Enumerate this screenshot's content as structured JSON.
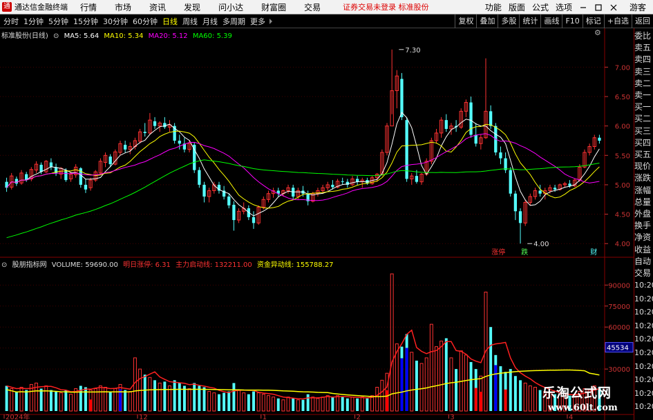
{
  "menubar": {
    "app_name": "通达信金融终端",
    "items": [
      "行情",
      "市场",
      "资讯",
      "发现",
      "问小达",
      "财富圈",
      "交易"
    ],
    "notice": "证券交易未登录  标准股份",
    "right_items": [
      "功能",
      "版面",
      "公式",
      "选项"
    ],
    "user": "游客"
  },
  "periodbar": {
    "periods": [
      "分时",
      "1分钟",
      "5分钟",
      "15分钟",
      "30分钟",
      "60分钟",
      "日线",
      "周线",
      "月线",
      "多周期",
      "更多"
    ],
    "active": "日线",
    "tools": [
      "复权",
      "叠加",
      "多股",
      "统计",
      "画线",
      "F10",
      "标记",
      "+自选",
      "返回"
    ]
  },
  "price_legend": {
    "stock": "标准股份(日线)",
    "ma5": "MA5: 5.64",
    "ma10": "MA10: 5.34",
    "ma20": "MA20: 5.12",
    "ma60": "MA60: 5.39",
    "colors": {
      "ma5": "#ffffff",
      "ma10": "#ffff00",
      "ma20": "#ff00ff",
      "ma60": "#00ff00"
    }
  },
  "vol_legend": {
    "indicator": "股朋指标网",
    "volume": "VOLUME: 59690.00",
    "next_limit": "明日涨停: 6.31",
    "main_line": "主力启动线: 132211.00",
    "abnormal_line": "资金异动线: 155788.27"
  },
  "right_panel": {
    "labels": [
      "委比",
      "卖五",
      "卖四",
      "卖三",
      "卖二",
      "卖一",
      "买一",
      "买二",
      "买三",
      "买四",
      "买五",
      "现价",
      "涨跌",
      "涨幅",
      "总量",
      "外盘",
      "换手",
      "净资",
      "收益",
      "自动",
      "交易"
    ],
    "times": [
      "10:20",
      "10:20",
      "10:20",
      "10:20",
      "10:20",
      "10:20",
      "10:20",
      "10:20",
      "10:20",
      "10:20"
    ]
  },
  "annotations": {
    "high_label": "7.30",
    "low_label": "4.00",
    "tags": [
      "涨停",
      "跌",
      "财"
    ],
    "current_volume_box": "45534"
  },
  "watermark": {
    "line1": "乐淘公式网",
    "line2": "www.60lt.com"
  },
  "chart_data": {
    "type": "candlestick",
    "price_axis": {
      "ticks": [
        4.0,
        4.5,
        5.0,
        5.5,
        6.0,
        6.5,
        7.0
      ],
      "range": [
        3.85,
        7.45
      ]
    },
    "volume_axis": {
      "ticks": [
        30000,
        45000,
        60000,
        75000,
        90000
      ],
      "range": [
        0,
        101000
      ]
    },
    "x_labels": [
      "2024年",
      "12",
      "1",
      "2",
      "3",
      "4"
    ],
    "x_label_index": [
      0,
      27,
      52,
      71,
      90,
      114
    ],
    "candles": [
      {
        "o": 5.05,
        "h": 5.12,
        "l": 4.88,
        "c": 4.95,
        "v": 18000
      },
      {
        "o": 4.96,
        "h": 5.2,
        "l": 4.92,
        "c": 5.15,
        "v": 16000
      },
      {
        "o": 5.1,
        "h": 5.14,
        "l": 4.98,
        "c": 5.02,
        "v": 14000
      },
      {
        "o": 5.03,
        "h": 5.25,
        "l": 5.0,
        "c": 5.2,
        "v": 17000
      },
      {
        "o": 5.18,
        "h": 5.22,
        "l": 5.05,
        "c": 5.08,
        "v": 15000
      },
      {
        "o": 5.1,
        "h": 5.3,
        "l": 5.06,
        "c": 5.26,
        "v": 19000
      },
      {
        "o": 5.25,
        "h": 5.4,
        "l": 5.2,
        "c": 5.35,
        "v": 20000
      },
      {
        "o": 5.34,
        "h": 5.38,
        "l": 5.18,
        "c": 5.22,
        "v": 16000
      },
      {
        "o": 5.22,
        "h": 5.42,
        "l": 5.2,
        "c": 5.4,
        "v": 18000
      },
      {
        "o": 5.38,
        "h": 5.45,
        "l": 5.25,
        "c": 5.3,
        "v": 15000
      },
      {
        "o": 5.3,
        "h": 5.36,
        "l": 5.15,
        "c": 5.2,
        "v": 14000
      },
      {
        "o": 5.18,
        "h": 5.3,
        "l": 5.1,
        "c": 5.28,
        "v": 13000
      },
      {
        "o": 5.25,
        "h": 5.28,
        "l": 5.05,
        "c": 5.08,
        "v": 15000
      },
      {
        "o": 5.1,
        "h": 5.22,
        "l": 5.05,
        "c": 5.18,
        "v": 12000
      },
      {
        "o": 5.17,
        "h": 5.35,
        "l": 5.12,
        "c": 5.3,
        "v": 16000
      },
      {
        "o": 5.28,
        "h": 5.3,
        "l": 4.95,
        "c": 5.0,
        "v": 18000
      },
      {
        "o": 5.0,
        "h": 5.1,
        "l": 4.86,
        "c": 4.92,
        "v": 17000
      },
      {
        "o": 4.95,
        "h": 5.12,
        "l": 4.9,
        "c": 5.08,
        "v": 15000
      },
      {
        "o": 5.08,
        "h": 5.25,
        "l": 5.05,
        "c": 5.22,
        "v": 16000
      },
      {
        "o": 5.2,
        "h": 5.45,
        "l": 5.18,
        "c": 5.4,
        "v": 18000
      },
      {
        "o": 5.38,
        "h": 5.55,
        "l": 5.3,
        "c": 5.5,
        "v": 17000
      },
      {
        "o": 5.48,
        "h": 5.52,
        "l": 5.3,
        "c": 5.35,
        "v": 14000
      },
      {
        "o": 5.35,
        "h": 5.6,
        "l": 5.33,
        "c": 5.56,
        "v": 16000
      },
      {
        "o": 5.55,
        "h": 5.75,
        "l": 5.5,
        "c": 5.7,
        "v": 19000
      },
      {
        "o": 5.68,
        "h": 5.75,
        "l": 5.55,
        "c": 5.6,
        "v": 15000
      },
      {
        "o": 5.6,
        "h": 5.72,
        "l": 5.52,
        "c": 5.65,
        "v": 14000
      },
      {
        "o": 5.65,
        "h": 5.8,
        "l": 5.6,
        "c": 5.75,
        "v": 38000
      },
      {
        "o": 5.74,
        "h": 5.95,
        "l": 5.7,
        "c": 5.9,
        "v": 30000
      },
      {
        "o": 5.9,
        "h": 6.05,
        "l": 5.82,
        "c": 5.88,
        "v": 26000
      },
      {
        "o": 5.88,
        "h": 6.22,
        "l": 5.85,
        "c": 6.1,
        "v": 24000
      },
      {
        "o": 6.08,
        "h": 6.15,
        "l": 5.95,
        "c": 6.0,
        "v": 22000
      },
      {
        "o": 6.0,
        "h": 6.08,
        "l": 5.9,
        "c": 6.05,
        "v": 20000
      },
      {
        "o": 6.05,
        "h": 6.15,
        "l": 5.95,
        "c": 5.98,
        "v": 21000
      },
      {
        "o": 5.98,
        "h": 6.1,
        "l": 5.9,
        "c": 6.02,
        "v": 18000
      },
      {
        "o": 6.0,
        "h": 6.05,
        "l": 5.7,
        "c": 5.75,
        "v": 22000
      },
      {
        "o": 5.75,
        "h": 5.85,
        "l": 5.6,
        "c": 5.7,
        "v": 20000
      },
      {
        "o": 5.7,
        "h": 5.8,
        "l": 5.55,
        "c": 5.6,
        "v": 18000
      },
      {
        "o": 5.6,
        "h": 5.75,
        "l": 5.55,
        "c": 5.7,
        "v": 16000
      },
      {
        "o": 5.68,
        "h": 5.72,
        "l": 5.2,
        "c": 5.25,
        "v": 20000
      },
      {
        "o": 5.25,
        "h": 5.3,
        "l": 4.95,
        "c": 5.0,
        "v": 18000
      },
      {
        "o": 5.0,
        "h": 5.05,
        "l": 4.7,
        "c": 4.8,
        "v": 17000
      },
      {
        "o": 4.8,
        "h": 4.95,
        "l": 4.7,
        "c": 4.9,
        "v": 14000
      },
      {
        "o": 4.9,
        "h": 5.05,
        "l": 4.85,
        "c": 5.0,
        "v": 13000
      },
      {
        "o": 5.0,
        "h": 5.05,
        "l": 4.85,
        "c": 4.9,
        "v": 12000
      },
      {
        "o": 4.9,
        "h": 4.98,
        "l": 4.75,
        "c": 4.8,
        "v": 13000
      },
      {
        "o": 4.8,
        "h": 4.85,
        "l": 4.6,
        "c": 4.65,
        "v": 14000
      },
      {
        "o": 4.66,
        "h": 4.72,
        "l": 4.22,
        "c": 4.4,
        "v": 20000
      },
      {
        "o": 4.4,
        "h": 4.6,
        "l": 4.35,
        "c": 4.55,
        "v": 15000
      },
      {
        "o": 4.55,
        "h": 4.7,
        "l": 4.5,
        "c": 4.6,
        "v": 13000
      },
      {
        "o": 4.6,
        "h": 4.65,
        "l": 4.4,
        "c": 4.45,
        "v": 12000
      },
      {
        "o": 4.45,
        "h": 4.55,
        "l": 4.25,
        "c": 4.35,
        "v": 14000
      },
      {
        "o": 4.35,
        "h": 4.65,
        "l": 4.32,
        "c": 4.62,
        "v": 13000
      },
      {
        "o": 4.62,
        "h": 4.8,
        "l": 4.58,
        "c": 4.75,
        "v": 12000
      },
      {
        "o": 4.75,
        "h": 4.9,
        "l": 4.7,
        "c": 4.85,
        "v": 11000
      },
      {
        "o": 4.85,
        "h": 4.95,
        "l": 4.78,
        "c": 4.9,
        "v": 10000
      },
      {
        "o": 4.9,
        "h": 4.95,
        "l": 4.8,
        "c": 4.85,
        "v": 9000
      },
      {
        "o": 4.85,
        "h": 4.92,
        "l": 4.8,
        "c": 4.9,
        "v": 8000
      },
      {
        "o": 4.9,
        "h": 5.0,
        "l": 4.85,
        "c": 4.95,
        "v": 10000
      },
      {
        "o": 4.95,
        "h": 5.0,
        "l": 4.75,
        "c": 4.8,
        "v": 9000
      },
      {
        "o": 4.8,
        "h": 4.95,
        "l": 4.75,
        "c": 4.9,
        "v": 8000
      },
      {
        "o": 4.9,
        "h": 4.98,
        "l": 4.8,
        "c": 4.85,
        "v": 8000
      },
      {
        "o": 4.85,
        "h": 4.9,
        "l": 4.65,
        "c": 4.72,
        "v": 12000
      },
      {
        "o": 4.72,
        "h": 4.88,
        "l": 4.7,
        "c": 4.85,
        "v": 10000
      },
      {
        "o": 4.85,
        "h": 4.95,
        "l": 4.8,
        "c": 4.9,
        "v": 9000
      },
      {
        "o": 4.9,
        "h": 5.0,
        "l": 4.85,
        "c": 4.95,
        "v": 10000
      },
      {
        "o": 4.95,
        "h": 5.05,
        "l": 4.9,
        "c": 5.0,
        "v": 11000
      },
      {
        "o": 5.0,
        "h": 5.08,
        "l": 4.92,
        "c": 4.96,
        "v": 10000
      },
      {
        "o": 4.96,
        "h": 5.1,
        "l": 4.94,
        "c": 5.06,
        "v": 11000
      },
      {
        "o": 5.06,
        "h": 5.12,
        "l": 5.0,
        "c": 5.05,
        "v": 10000
      },
      {
        "o": 5.05,
        "h": 5.1,
        "l": 4.95,
        "c": 5.0,
        "v": 9000
      },
      {
        "o": 5.0,
        "h": 5.15,
        "l": 4.98,
        "c": 5.1,
        "v": 10000
      },
      {
        "o": 5.1,
        "h": 5.15,
        "l": 5.0,
        "c": 5.05,
        "v": 9000
      },
      {
        "o": 5.05,
        "h": 5.12,
        "l": 4.95,
        "c": 5.08,
        "v": 10000
      },
      {
        "o": 5.08,
        "h": 5.12,
        "l": 5.0,
        "c": 5.02,
        "v": 9000
      },
      {
        "o": 5.02,
        "h": 5.15,
        "l": 5.0,
        "c": 5.12,
        "v": 11000
      },
      {
        "o": 5.12,
        "h": 5.2,
        "l": 5.05,
        "c": 5.18,
        "v": 17000
      },
      {
        "o": 5.18,
        "h": 5.6,
        "l": 5.15,
        "c": 5.55,
        "v": 22000
      },
      {
        "o": 5.55,
        "h": 6.05,
        "l": 5.5,
        "c": 6.0,
        "v": 27000
      },
      {
        "o": 6.0,
        "h": 7.3,
        "l": 6.2,
        "c": 6.6,
        "v": 98000
      },
      {
        "o": 6.6,
        "h": 6.95,
        "l": 6.3,
        "c": 6.85,
        "v": 48000
      },
      {
        "o": 6.8,
        "h": 6.9,
        "l": 6.1,
        "c": 6.15,
        "v": 46000
      },
      {
        "o": 6.1,
        "h": 6.15,
        "l": 5.05,
        "c": 5.1,
        "v": 55000
      },
      {
        "o": 5.1,
        "h": 5.2,
        "l": 5.0,
        "c": 5.15,
        "v": 42000
      },
      {
        "o": 5.15,
        "h": 5.25,
        "l": 5.02,
        "c": 5.05,
        "v": 36000
      },
      {
        "o": 5.05,
        "h": 5.2,
        "l": 5.0,
        "c": 5.18,
        "v": 34000
      },
      {
        "o": 5.18,
        "h": 5.45,
        "l": 5.15,
        "c": 5.4,
        "v": 38000
      },
      {
        "o": 5.4,
        "h": 5.8,
        "l": 5.35,
        "c": 5.75,
        "v": 62000
      },
      {
        "o": 5.75,
        "h": 5.95,
        "l": 5.7,
        "c": 5.88,
        "v": 46000
      },
      {
        "o": 5.88,
        "h": 6.15,
        "l": 5.8,
        "c": 6.1,
        "v": 50000
      },
      {
        "o": 6.1,
        "h": 6.2,
        "l": 5.9,
        "c": 5.95,
        "v": 52000
      },
      {
        "o": 5.95,
        "h": 6.05,
        "l": 5.85,
        "c": 6.0,
        "v": 38000
      },
      {
        "o": 6.0,
        "h": 6.1,
        "l": 5.9,
        "c": 5.98,
        "v": 30000
      },
      {
        "o": 5.98,
        "h": 6.3,
        "l": 5.95,
        "c": 6.25,
        "v": 43000
      },
      {
        "o": 6.25,
        "h": 6.45,
        "l": 6.15,
        "c": 6.4,
        "v": 40000
      },
      {
        "o": 6.4,
        "h": 6.5,
        "l": 5.8,
        "c": 5.85,
        "v": 35000
      },
      {
        "o": 5.85,
        "h": 6.05,
        "l": 5.65,
        "c": 5.7,
        "v": 30000
      },
      {
        "o": 5.7,
        "h": 5.85,
        "l": 5.6,
        "c": 5.8,
        "v": 25000
      },
      {
        "o": 5.8,
        "h": 7.15,
        "l": 5.78,
        "c": 6.25,
        "v": 85000
      },
      {
        "o": 6.25,
        "h": 6.35,
        "l": 5.95,
        "c": 6.0,
        "v": 60000
      },
      {
        "o": 6.0,
        "h": 6.05,
        "l": 5.5,
        "c": 5.55,
        "v": 40000
      },
      {
        "o": 5.55,
        "h": 5.65,
        "l": 5.35,
        "c": 5.45,
        "v": 32000
      },
      {
        "o": 5.45,
        "h": 5.55,
        "l": 5.2,
        "c": 5.25,
        "v": 28000
      },
      {
        "o": 5.25,
        "h": 5.3,
        "l": 4.8,
        "c": 4.85,
        "v": 30000
      },
      {
        "o": 4.85,
        "h": 4.9,
        "l": 4.4,
        "c": 4.55,
        "v": 25000
      },
      {
        "o": 4.55,
        "h": 4.6,
        "l": 4.0,
        "c": 4.35,
        "v": 22000
      },
      {
        "o": 4.35,
        "h": 4.75,
        "l": 4.3,
        "c": 4.7,
        "v": 20000
      },
      {
        "o": 4.7,
        "h": 4.85,
        "l": 4.65,
        "c": 4.8,
        "v": 18000
      },
      {
        "o": 4.8,
        "h": 4.95,
        "l": 4.75,
        "c": 4.9,
        "v": 17000
      },
      {
        "o": 4.9,
        "h": 5.0,
        "l": 4.8,
        "c": 4.85,
        "v": 15000
      },
      {
        "o": 4.85,
        "h": 4.95,
        "l": 4.75,
        "c": 4.9,
        "v": 14000
      },
      {
        "o": 4.9,
        "h": 5.0,
        "l": 4.85,
        "c": 4.95,
        "v": 13000
      },
      {
        "o": 4.95,
        "h": 5.0,
        "l": 4.88,
        "c": 4.92,
        "v": 12000
      },
      {
        "o": 4.92,
        "h": 5.02,
        "l": 4.9,
        "c": 5.0,
        "v": 12000
      },
      {
        "o": 5.0,
        "h": 5.05,
        "l": 4.95,
        "c": 5.02,
        "v": 11000
      },
      {
        "o": 5.02,
        "h": 5.08,
        "l": 4.95,
        "c": 4.98,
        "v": 11000
      },
      {
        "o": 4.98,
        "h": 5.1,
        "l": 4.96,
        "c": 5.08,
        "v": 12000
      },
      {
        "o": 5.08,
        "h": 5.35,
        "l": 5.05,
        "c": 5.3,
        "v": 14000
      },
      {
        "o": 5.3,
        "h": 5.6,
        "l": 5.28,
        "c": 5.55,
        "v": 16000
      },
      {
        "o": 5.55,
        "h": 5.7,
        "l": 5.5,
        "c": 5.65,
        "v": 15000
      },
      {
        "o": 5.65,
        "h": 5.85,
        "l": 5.6,
        "c": 5.8,
        "v": 18000
      },
      {
        "o": 5.8,
        "h": 5.85,
        "l": 5.7,
        "c": 5.75,
        "v": 17000
      }
    ],
    "ma_colors": {
      "ma5": "#ffffff",
      "ma10": "#ffff00",
      "ma20": "#ff00ff",
      "ma60": "#00ff00"
    },
    "volume_colors": {
      "up": "#ff3232",
      "down": "#54ffff",
      "blue": "#0000ff",
      "red_fill": "#ff0000"
    }
  }
}
